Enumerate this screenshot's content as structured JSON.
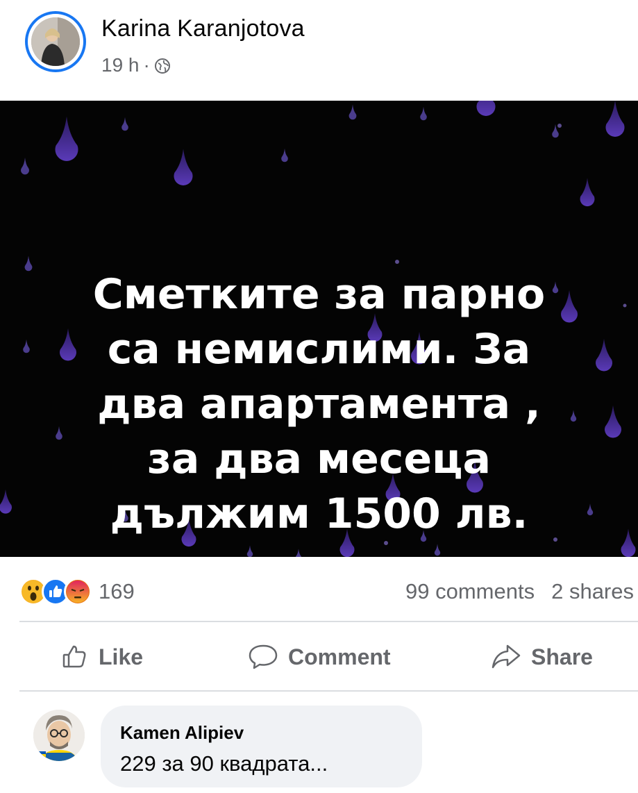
{
  "post": {
    "author": "Karina Karanjotova",
    "time": "19 h",
    "separator": "·",
    "privacy_icon": "globe-icon"
  },
  "image": {
    "lines": [
      "Сметките за парно",
      "са немислими. За",
      "два апартамента ,",
      "за два месеца",
      "дължим 1500 лв."
    ],
    "background": "#040404",
    "drop_color": "#4a2f9a"
  },
  "stats": {
    "reaction_icons": [
      "wow-icon",
      "like-icon",
      "angry-icon"
    ],
    "reaction_count": "169",
    "comments": "99 comments",
    "shares": "2 shares"
  },
  "actions": {
    "like": "Like",
    "comment": "Comment",
    "share": "Share"
  },
  "comment": {
    "author": "Kamen Alipiev",
    "text": "229 за 90 квадрата..."
  },
  "colors": {
    "accent": "#1877f2",
    "secondary_text": "#65676b",
    "bubble": "#f0f2f5"
  }
}
